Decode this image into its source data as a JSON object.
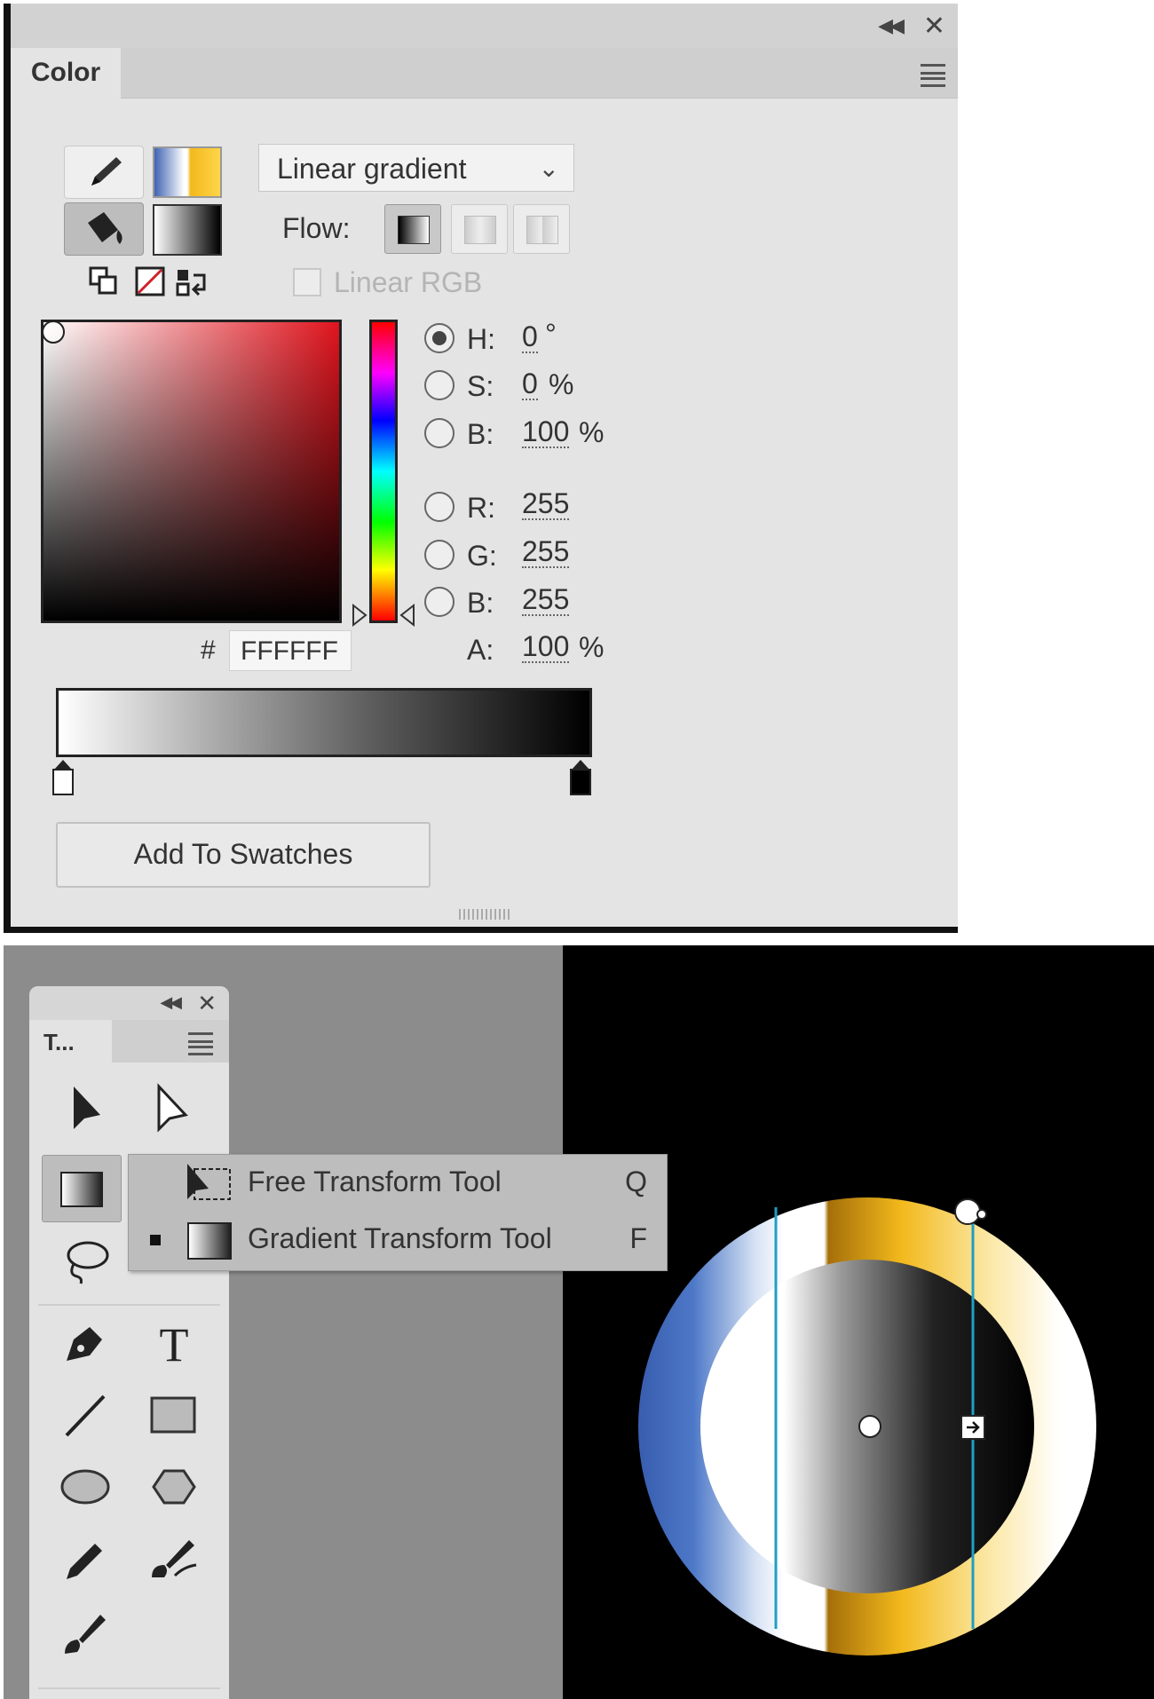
{
  "color_panel": {
    "title": "Color",
    "fill_type": "Linear gradient",
    "flow_label": "Flow:",
    "linear_rgb_label": "Linear RGB",
    "fields": {
      "h": {
        "label": "H:",
        "value": "0",
        "unit": "°"
      },
      "s": {
        "label": "S:",
        "value": "0",
        "unit": "%"
      },
      "b_hsb": {
        "label": "B:",
        "value": "100",
        "unit": "%"
      },
      "r": {
        "label": "R:",
        "value": "255"
      },
      "g": {
        "label": "G:",
        "value": "255"
      },
      "b_rgb": {
        "label": "B:",
        "value": "255"
      },
      "a": {
        "label": "A:",
        "value": "100",
        "unit": "%"
      }
    },
    "hex_prefix": "#",
    "hex_value": "FFFFFF",
    "add_to_swatches": "Add To Swatches",
    "gradient_stops": [
      "#ffffff",
      "#000000"
    ]
  },
  "tools_panel": {
    "title": "T...",
    "flyout": [
      {
        "label": "Free Transform Tool",
        "shortcut": "Q",
        "selected": false
      },
      {
        "label": "Gradient Transform Tool",
        "shortcut": "F",
        "selected": true
      }
    ]
  },
  "colors": {
    "stage": "#000000",
    "ring_blue": "#3f63b3",
    "ring_gold": "#f2b91c",
    "handle_line": "#1e9fc4"
  }
}
